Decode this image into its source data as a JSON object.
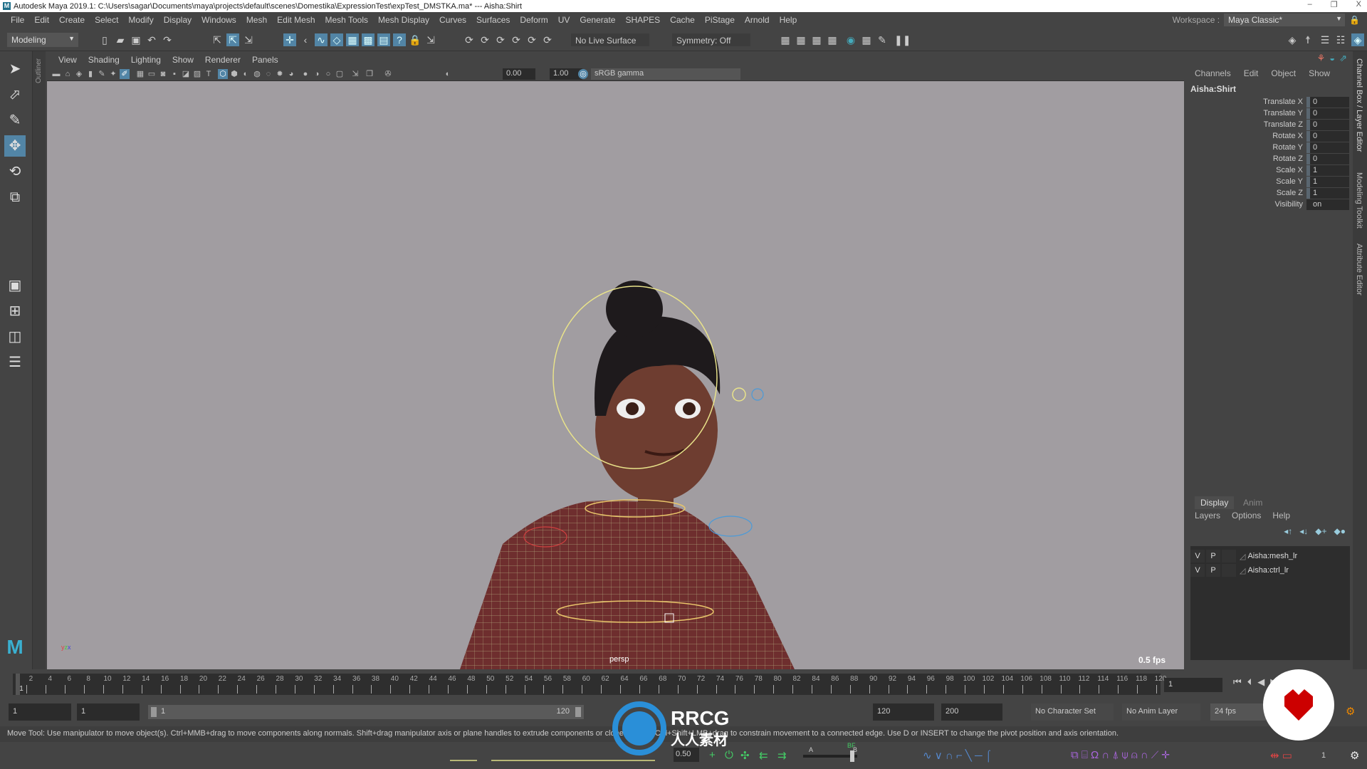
{
  "titlebar": {
    "text": "Autodesk Maya 2019.1: C:\\Users\\sagar\\Documents\\maya\\projects\\default\\scenes\\Domestika\\ExpressionTest\\expTest_DMSTKA.ma*  ---  Aisha:Shirt",
    "logo": "M",
    "min": "–",
    "max": "❐",
    "close": "X"
  },
  "menu": [
    "File",
    "Edit",
    "Create",
    "Select",
    "Modify",
    "Display",
    "Windows",
    "Mesh",
    "Edit Mesh",
    "Mesh Tools",
    "Mesh Display",
    "Curves",
    "Surfaces",
    "Deform",
    "UV",
    "Generate",
    "SHAPES",
    "Cache",
    "PiStage",
    "Arnold",
    "Help"
  ],
  "workspace": {
    "label": "Workspace :",
    "value": "Maya Classic*"
  },
  "toolbar": {
    "mode": "Modeling",
    "live_surface": "No Live Surface",
    "symmetry": "Symmetry: Off"
  },
  "outliner_label": "Outliner",
  "viewport": {
    "menu": [
      "View",
      "Shading",
      "Lighting",
      "Show",
      "Renderer",
      "Panels"
    ],
    "exposure": "0.00",
    "gamma": "1.00",
    "colorspace": "sRGB gamma",
    "camera": "persp",
    "fps": "0.5 fps"
  },
  "channel_box": {
    "menu": [
      "Channels",
      "Edit",
      "Object",
      "Show"
    ],
    "object": "Aisha:Shirt",
    "channels": [
      {
        "label": "Translate X",
        "value": "0"
      },
      {
        "label": "Translate Y",
        "value": "0"
      },
      {
        "label": "Translate Z",
        "value": "0"
      },
      {
        "label": "Rotate X",
        "value": "0"
      },
      {
        "label": "Rotate Y",
        "value": "0"
      },
      {
        "label": "Rotate Z",
        "value": "0"
      },
      {
        "label": "Scale X",
        "value": "1"
      },
      {
        "label": "Scale Y",
        "value": "1"
      },
      {
        "label": "Scale Z",
        "value": "1"
      },
      {
        "label": "Visibility",
        "value": "on"
      }
    ]
  },
  "side_tabs": [
    "Channel Box / Layer Editor",
    "Modeling Toolkit",
    "Attribute Editor"
  ],
  "layers": {
    "tabs": [
      "Display",
      "Anim"
    ],
    "menu": [
      "Layers",
      "Options",
      "Help"
    ],
    "rows": [
      {
        "v": "V",
        "p": "P",
        "name": "Aisha:mesh_lr"
      },
      {
        "v": "V",
        "p": "P",
        "name": "Aisha:ctrl_lr"
      }
    ]
  },
  "timeline": {
    "start": 1,
    "end": 120,
    "current_frame": "1"
  },
  "range": {
    "start": "1",
    "anim_start": "1",
    "slider_start": "1",
    "slider_end": "120",
    "end": "120",
    "anim_end": "200",
    "character_set": "No Character Set",
    "anim_layer": "No Anim Layer",
    "fps": "24 fps"
  },
  "help_line": "Move Tool: Use manipulator to move object(s). Ctrl+MMB+drag to move components along normals. Shift+drag manipulator axis or plane handles to extrude components or clone objects. Ctrl+Shift+LMB+drag to constrain movement to a connected edge. Use D or INSERT to change the pivot position and axis orientation.",
  "bottom": {
    "value": "0.50",
    "slider_a": "A",
    "slider_bf": "BF",
    "slider_b": "B",
    "frame": "1"
  },
  "watermark": {
    "text": "RRCG",
    "sub": "人人素材"
  },
  "colors": {
    "accent": "#5285a6",
    "viewport_bg": "#a19da1",
    "panel": "#444444"
  }
}
